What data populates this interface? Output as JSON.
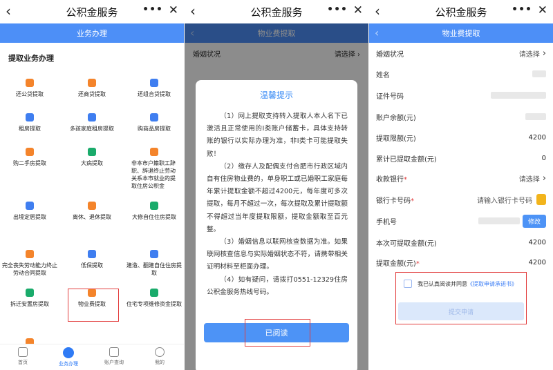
{
  "screen1": {
    "nav": {
      "title": "公积金服务"
    },
    "subbar_title": "业务办理",
    "section_title": "提取业务办理",
    "services": [
      {
        "label": "还公贷提取",
        "color": "#f4842b"
      },
      {
        "label": "还商贷提取",
        "color": "#f4842b"
      },
      {
        "label": "还组合贷提取",
        "color": "#3f7ef0"
      },
      {
        "label": "租房提取",
        "color": "#3f7ef0"
      },
      {
        "label": "多孩家庭租房提取",
        "color": "#3f7ef0"
      },
      {
        "label": "购商品房提取",
        "color": "#3f7ef0"
      },
      {
        "label": "购二手房提取",
        "color": "#f4842b"
      },
      {
        "label": "大病提取",
        "color": "#1aab6b"
      },
      {
        "label": "非本市户籍职工辞职、辞退终止劳动关系本市就业的提取住房公积金",
        "color": "#f4842b"
      },
      {
        "label": "出境定居提取",
        "color": "#3f7ef0"
      },
      {
        "label": "离休、退休提取",
        "color": "#f4842b"
      },
      {
        "label": "大修自住住房提取",
        "color": "#1aab6b"
      },
      {
        "label": "完全丧失劳动能力终止劳动合同提取",
        "color": "#f4842b"
      },
      {
        "label": "低保提取",
        "color": "#3f7ef0"
      },
      {
        "label": "建造、翻建自住住房提取",
        "color": "#3f7ef0"
      },
      {
        "label": "拆迁安置房提取",
        "color": "#1aab6b"
      },
      {
        "label": "物业费提取",
        "color": "#f4842b"
      },
      {
        "label": "住宅专项维修资金提取",
        "color": "#1aab6b"
      }
    ],
    "tabs": [
      {
        "label": "首页"
      },
      {
        "label": "业务办理"
      },
      {
        "label": "账户查询"
      },
      {
        "label": "我的"
      }
    ]
  },
  "screen2": {
    "nav": {
      "title": "公积金服务"
    },
    "subbar_title": "物业费提取",
    "row_label": "婚姻状况",
    "row_value": "请选择",
    "dialog_title": "温馨提示",
    "paragraphs": [
      "（1）网上提取支持转入提取人本人名下已激活且正常使用的I类账户储蓄卡，具体支持转账的银行以实际办理为准，非I类卡可能提取失败！",
      "（2）缴存人及配偶支付合肥市行政区域内自有住房物业费的，单身职工或已婚职工家庭每年累计提取金额不超过4200元，每年度可多次提取，每月不超过一次，每次提取及累计提取额不得超过当年度提取限额，提取金额取至百元整。",
      "（3）婚姻信息以联网核查数据为准。如果联网核查信息与实际婚姻状态不符，请携带相关证明材料至柜面办理。",
      "（4）如有疑问，请拨打0551-12329住房公积金服务热线号码。"
    ],
    "confirm_label": "已阅读"
  },
  "screen3": {
    "nav": {
      "title": "公积金服务"
    },
    "subbar_title": "物业费提取",
    "rows": [
      {
        "label": "婚姻状况",
        "value": "请选择",
        "kind": "select"
      },
      {
        "label": "姓名",
        "value": "",
        "kind": "masked"
      },
      {
        "label": "证件号码",
        "value": "",
        "kind": "masked"
      },
      {
        "label": "账户余额(元)",
        "value": "",
        "kind": "masked"
      },
      {
        "label": "提取限额(元)",
        "value": "4200",
        "kind": "text"
      },
      {
        "label": "累计已提取金额(元)",
        "value": "0",
        "kind": "text"
      },
      {
        "label": "收款银行",
        "required": "*",
        "value": "请选择",
        "kind": "select"
      },
      {
        "label": "银行卡号码",
        "required": "*",
        "value": "请输入银行卡号码",
        "kind": "input"
      },
      {
        "label": "手机号",
        "value": "",
        "kind": "phone"
      },
      {
        "label": "本次可提取金额(元)",
        "value": "4200",
        "kind": "text"
      },
      {
        "label": "提取金额(元)",
        "required": "*",
        "value": "4200",
        "kind": "text"
      }
    ],
    "edit_label": "修改",
    "agree_text": "我已认真阅读并同意",
    "agree_link": "《提取申请承诺书》",
    "submit_label": "提交申请"
  }
}
